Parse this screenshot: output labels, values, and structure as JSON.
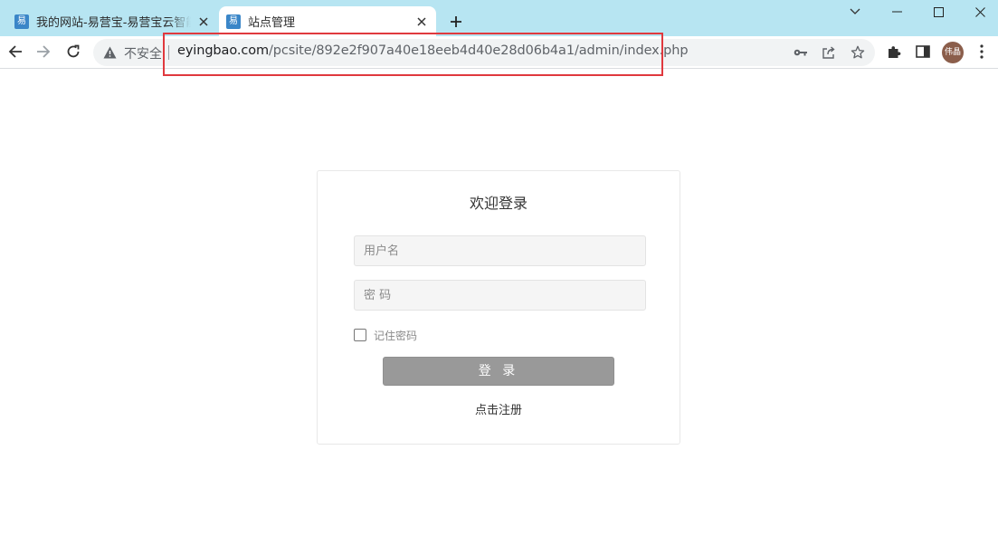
{
  "browser": {
    "tabs": [
      {
        "favicon_text": "易",
        "title": "我的网站-易营宝-易营宝云智能建站"
      },
      {
        "favicon_text": "易",
        "title": "站点管理"
      }
    ],
    "active_tab_index": 1,
    "address_bar": {
      "security_label": "不安全",
      "url_host": "eyingbao.com",
      "url_path": "/pcsite/892e2f907a40e18eeb4d40e28d06b4a1/admin/index.php"
    },
    "profile_avatar_text": "伟晶",
    "icons": {
      "new_tab": "plus-icon",
      "back": "arrow-left-icon",
      "forward": "arrow-right-icon",
      "reload": "reload-icon",
      "warning": "warning-triangle-icon",
      "key": "key-icon",
      "share": "share-icon",
      "bookmark": "star-icon",
      "extensions": "puzzle-icon",
      "side_panel": "side-panel-icon",
      "menu": "kebab-menu-icon"
    },
    "colors": {
      "tabstrip": "#b7e5f2",
      "highlight": "#e0393e"
    }
  },
  "login": {
    "title": "欢迎登录",
    "username_placeholder": "用户名",
    "password_placeholder": "密 码",
    "remember_label": "记住密码",
    "remember_checked": false,
    "submit_label": "登 录",
    "register_link": "点击注册",
    "colors": {
      "submit_bg": "#999999"
    }
  }
}
